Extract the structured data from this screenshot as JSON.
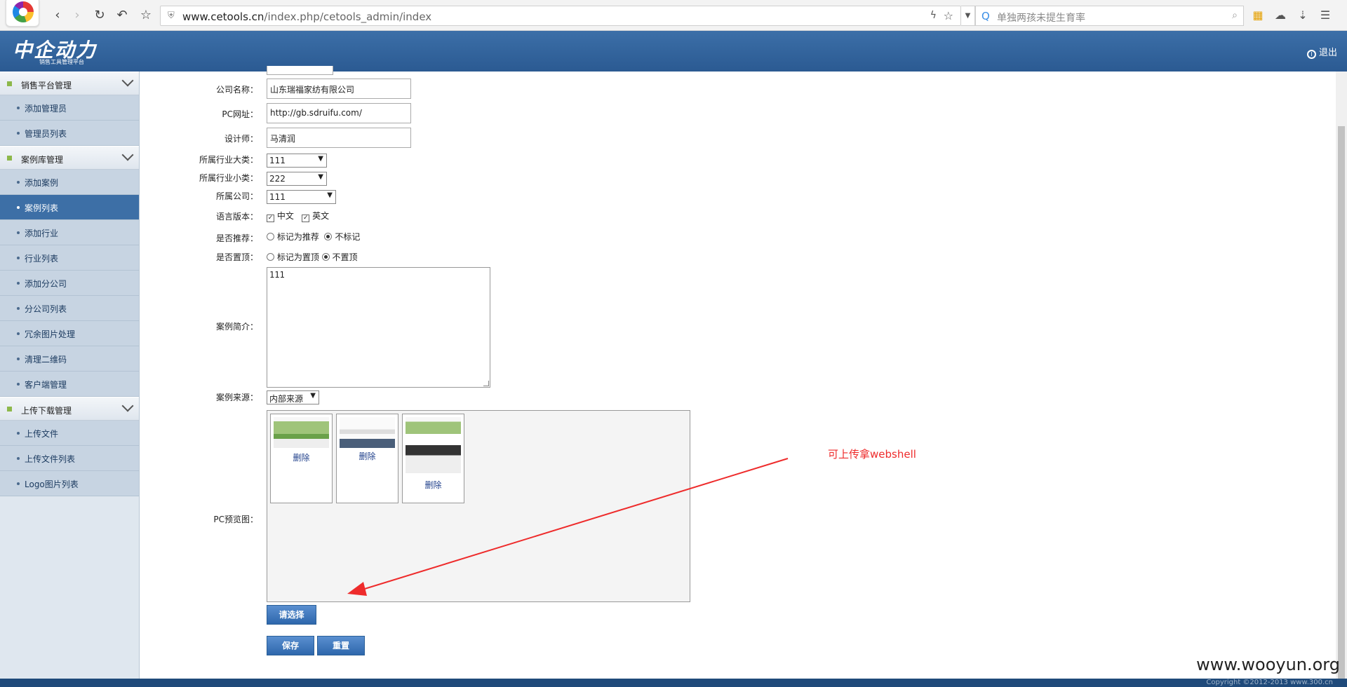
{
  "browser": {
    "url_host": "www.cetools.cn",
    "url_path": "/index.php/cetools_admin/index",
    "search_placeholder": "单独两孩未提生育率"
  },
  "header": {
    "logo_text": "中企动力",
    "logo_sub": "销售工具管理平台",
    "logout_label": "退出"
  },
  "sidebar": {
    "sections": [
      {
        "title": "销售平台管理",
        "items": [
          "添加管理员",
          "管理员列表"
        ]
      },
      {
        "title": "案例库管理",
        "items": [
          "添加案例",
          "案例列表",
          "添加行业",
          "行业列表",
          "添加分公司",
          "分公司列表",
          "冗余图片处理",
          "清理二维码",
          "客户端管理"
        ]
      },
      {
        "title": "上传下载管理",
        "items": [
          "上传文件",
          "上传文件列表",
          "Logo图片列表"
        ]
      }
    ],
    "active_item": "案例列表"
  },
  "form": {
    "company_label": "公司名称：",
    "company_value": "山东瑞福家纺有限公司",
    "pc_url_label": "PC网址：",
    "pc_url_value": "http://gb.sdruifu.com/",
    "designer_label": "设计师：",
    "designer_value": "马清润",
    "industry_major_label": "所属行业大类：",
    "industry_major_value": "111",
    "industry_minor_label": "所属行业小类：",
    "industry_minor_value": "222",
    "branch_label": "所属公司：",
    "branch_value": "111",
    "lang_label": "语言版本：",
    "lang_zh": "中文",
    "lang_en": "英文",
    "recommend_label": "是否推荐：",
    "recommend_yes": "标记为推荐",
    "recommend_no": "不标记",
    "top_label": "是否置顶：",
    "top_yes": "标记为置顶",
    "top_no": "不置顶",
    "intro_label": "案例简介：",
    "intro_value": "111",
    "source_label": "案例来源：",
    "source_value": "内部来源",
    "preview_label": "PC预览图：",
    "delete_label": "删除",
    "choose_button": "请选择",
    "save_button": "保存",
    "reset_button": "重置"
  },
  "annotation": "可上传拿webshell",
  "watermark": "www.wooyun.org",
  "copyright": "Copyright ©2012-2013 www.300.cn",
  "colors": {
    "header": "#2f619a",
    "annotation": "#ee2b2b",
    "active_item": "#3d6fa6"
  }
}
